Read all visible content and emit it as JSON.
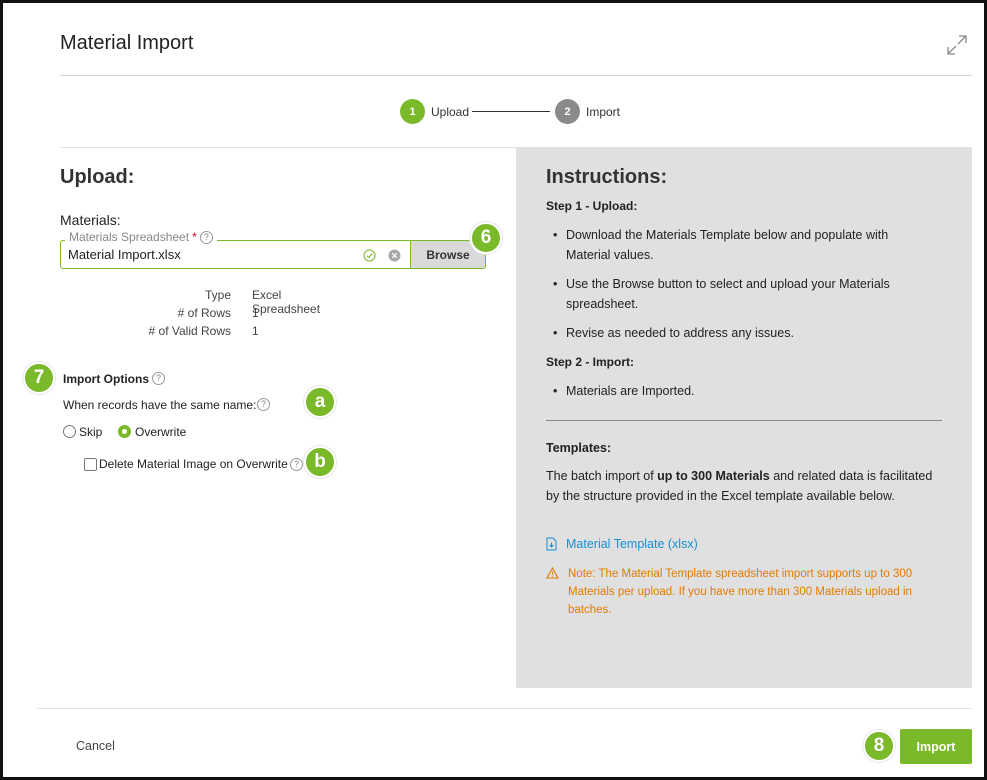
{
  "dialog": {
    "title": "Material Import"
  },
  "stepper": {
    "steps": [
      {
        "number": "1",
        "label": "Upload",
        "state": "active"
      },
      {
        "number": "2",
        "label": "Import",
        "state": "pending"
      }
    ]
  },
  "upload": {
    "heading": "Upload:",
    "materials_label": "Materials:",
    "spreadsheet_field": {
      "label": "Materials Spreadsheet",
      "required_mark": "*",
      "value": "Material Import.xlsx"
    },
    "browse_label": "Browse",
    "file_info": [
      {
        "key": "Type",
        "value": "Excel Spreadsheet"
      },
      {
        "key": "# of Rows",
        "value": "1"
      },
      {
        "key": "# of Valid Rows",
        "value": "1"
      }
    ]
  },
  "import_options": {
    "title": "Import Options",
    "same_name_label": "When records have the same name:",
    "radio_options": [
      {
        "label": "Skip",
        "checked": false
      },
      {
        "label": "Overwrite",
        "checked": true
      }
    ],
    "delete_image_label": "Delete Material Image on Overwrite",
    "delete_image_checked": false
  },
  "callouts": {
    "browse": "6",
    "options": "7",
    "same_name": "a",
    "delete_image": "b",
    "import": "8"
  },
  "instructions": {
    "heading": "Instructions:",
    "step1_heading": "Step 1 - Upload:",
    "step1_bullets": [
      "Download the Materials Template below and populate with Material values.",
      "Use the Browse button to select and upload your Materials spreadsheet.",
      "Revise as needed to address any issues."
    ],
    "step2_heading": "Step 2 - Import:",
    "step2_bullets": [
      "Materials are Imported."
    ],
    "templates_heading": "Templates:",
    "templates_text_pre": "The batch import of ",
    "templates_text_bold": "up to 300 Materials",
    "templates_text_post": " and related data is facilitated by the structure provided in the Excel template available below.",
    "template_link": "Material Template (xlsx)",
    "note": "Note: The Material Template spreadsheet import supports up to 300 Materials per upload. If you have more than 300 Materials upload in batches."
  },
  "footer": {
    "cancel_label": "Cancel",
    "import_label": "Import"
  },
  "colors": {
    "accent": "#7ab929",
    "pending": "#8a8a8a",
    "link": "#1a8fd6",
    "warning": "#e07b00",
    "panel": "#e0e0e0"
  }
}
